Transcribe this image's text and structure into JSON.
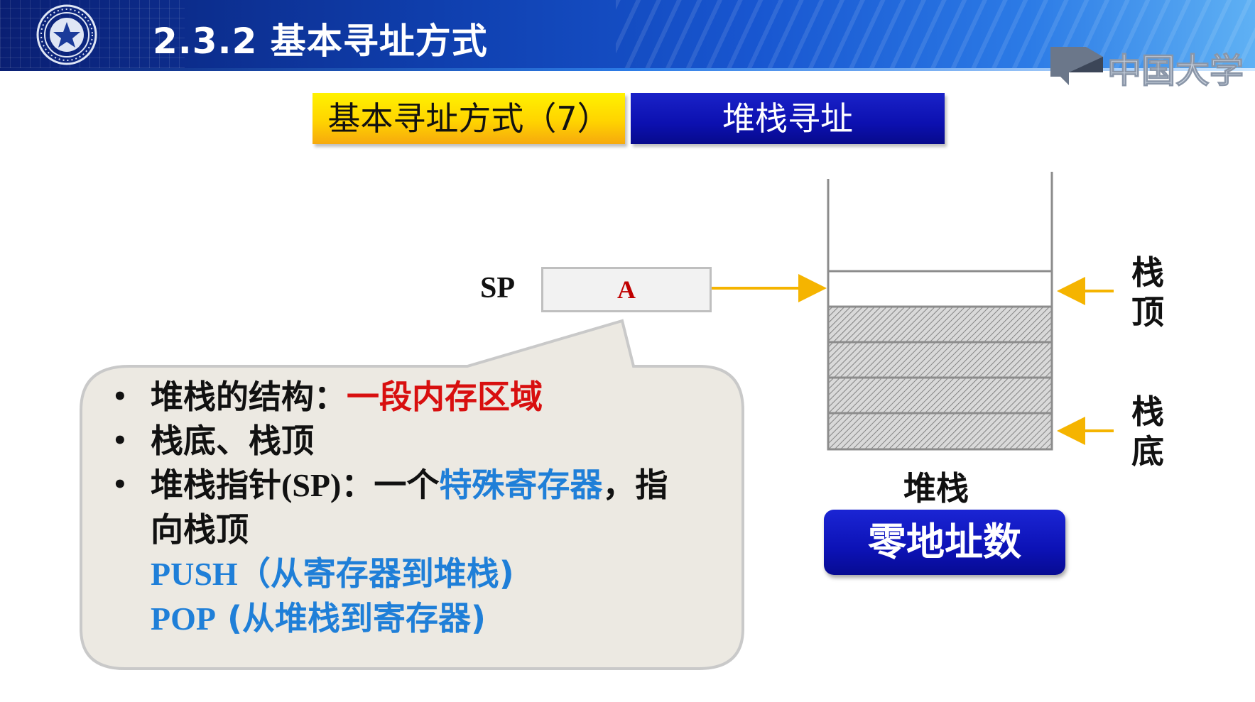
{
  "header": {
    "title": "2.3.2 基本寻址方式",
    "brand": "中国大学"
  },
  "tabs": {
    "section": "基本寻址方式（7）",
    "topic": "堆栈寻址"
  },
  "register": {
    "label": "SP",
    "value": "A"
  },
  "stack": {
    "caption": "堆栈",
    "top_label": [
      "栈",
      "顶"
    ],
    "bottom_label": [
      "栈",
      "底"
    ],
    "filled_cells": 4
  },
  "zero_address_button": "零地址数",
  "callout": {
    "item1": {
      "prefix": "堆栈的结构：",
      "highlight": "一段内存区域"
    },
    "item2": {
      "text": "栈底、栈顶"
    },
    "item3": {
      "prefix": "堆栈指针",
      "paren": "(SP)",
      "mid": "：一个",
      "highlight": "特殊寄存器",
      "suffix": "，指",
      "line2": "向栈顶"
    },
    "push": {
      "keyword": "PUSH",
      "text": "（从寄存器到堆栈)"
    },
    "pop": {
      "keyword": "POP",
      "text": "(从堆栈到寄存器)"
    }
  },
  "colors": {
    "header_dark": "#0a1f73",
    "tab_yellow": "#ffd400",
    "tab_blue": "#0c10b0",
    "arrow": "#f5b400",
    "red_text": "#d80f0f",
    "blue_text": "#1f7fd8",
    "callout_fill": "#ece9e2"
  }
}
